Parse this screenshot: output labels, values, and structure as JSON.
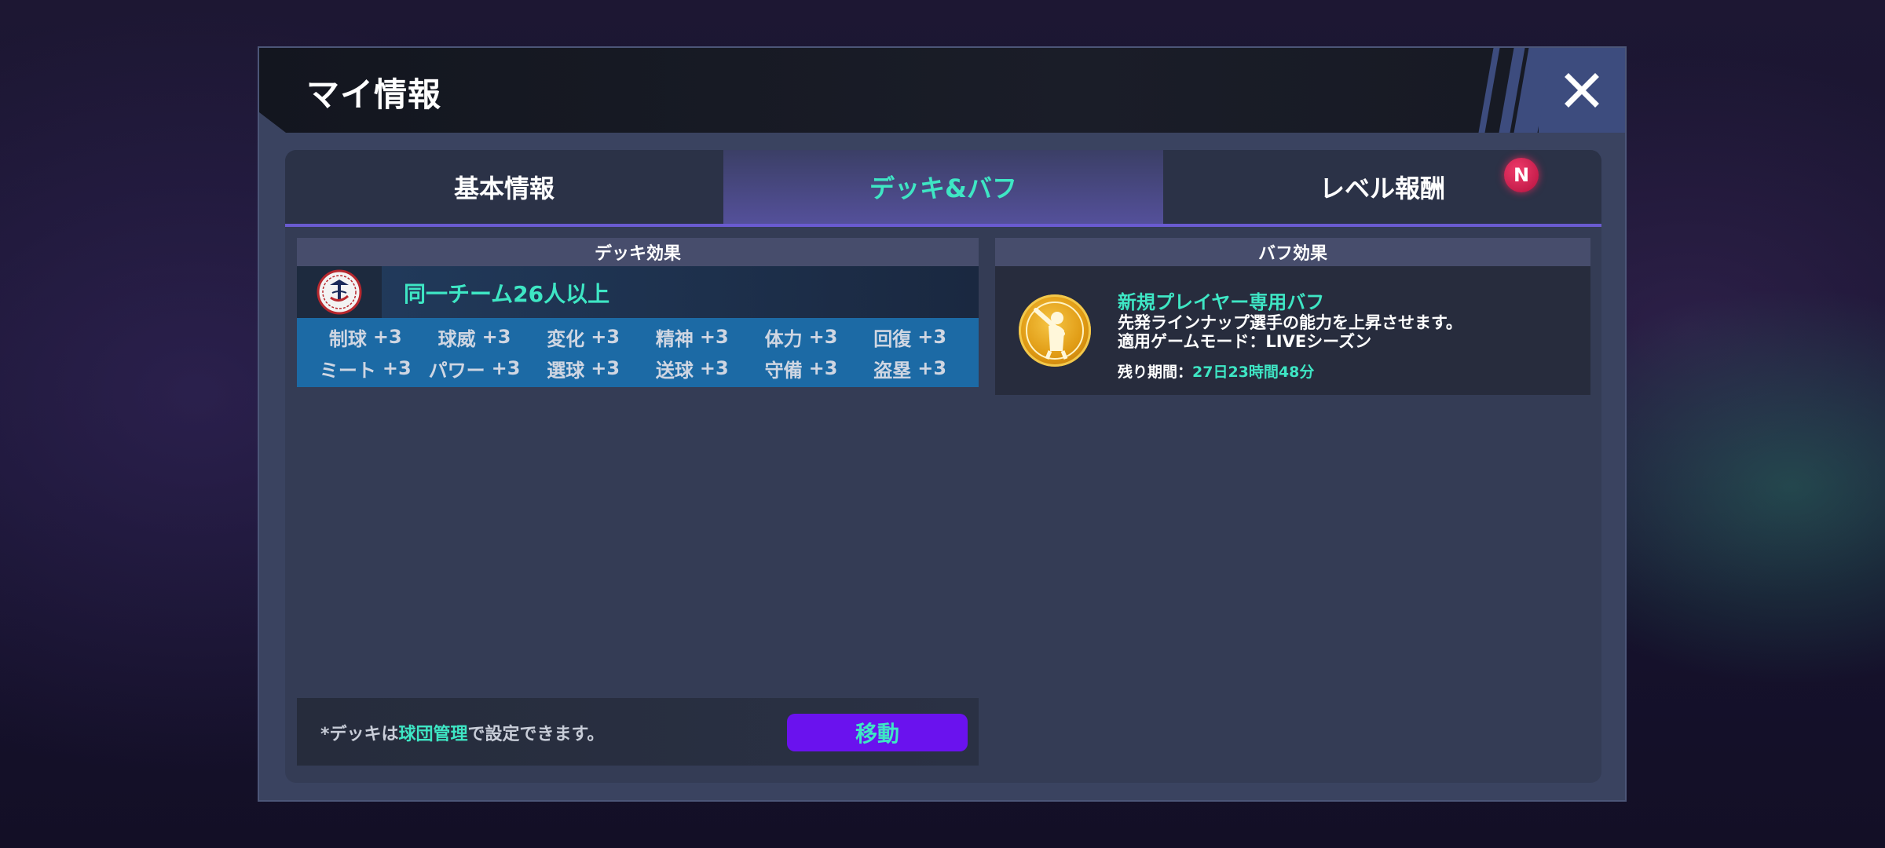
{
  "dialog": {
    "title": "マイ情報",
    "close_label": "X"
  },
  "tabs": [
    {
      "label": "基本情報",
      "active": false
    },
    {
      "label": "デッキ&バフ",
      "active": true
    },
    {
      "label": "レベル報酬",
      "active": false,
      "badge": "N"
    }
  ],
  "deck": {
    "header": "デッキ効果",
    "team_logo": "yankees-logo",
    "condition": "同一チーム26人以上",
    "stats": [
      {
        "name": "制球",
        "value": "+3"
      },
      {
        "name": "球威",
        "value": "+3"
      },
      {
        "name": "変化",
        "value": "+3"
      },
      {
        "name": "精神",
        "value": "+3"
      },
      {
        "name": "体力",
        "value": "+3"
      },
      {
        "name": "回復",
        "value": "+3"
      },
      {
        "name": "ミート",
        "value": "+3"
      },
      {
        "name": "パワー",
        "value": "+3"
      },
      {
        "name": "選球",
        "value": "+3"
      },
      {
        "name": "送球",
        "value": "+3"
      },
      {
        "name": "守備",
        "value": "+3"
      },
      {
        "name": "盗塁",
        "value": "+3"
      }
    ],
    "footer_prefix": "*デッキは",
    "footer_highlight": "球団管理",
    "footer_suffix": "で設定できます。",
    "move_button": "移動"
  },
  "buff": {
    "header": "バフ効果",
    "icon": "batter-icon",
    "title": "新規プレイヤー専用バフ",
    "desc_line1": "先発ラインナップ選手の能力を上昇させます。",
    "desc_line2": "適用ゲームモード：LIVEシーズン",
    "remain_label": "残り期間：",
    "remain_value": "27日23時間48分"
  },
  "colors": {
    "accent": "#3ee6c4",
    "tab_underline": "#6a5bd0",
    "move_button": "#6a12ee",
    "stat_bar": "#1c6aa5"
  }
}
